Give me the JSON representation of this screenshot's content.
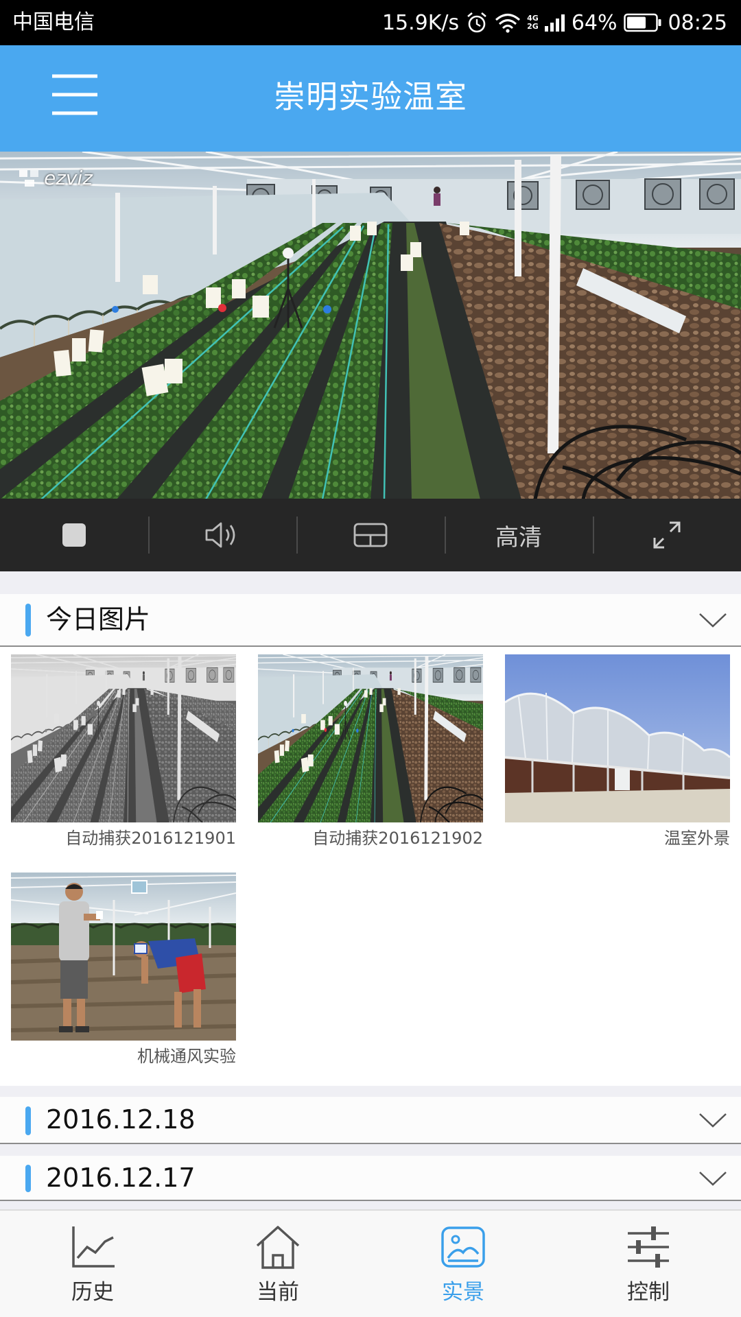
{
  "status_bar": {
    "carrier": "中国电信",
    "net_speed": "15.9K/s",
    "network_types": [
      "4G",
      "2G"
    ],
    "battery": "64%",
    "time": "08:25",
    "icons": [
      "alarm-icon",
      "wifi-icon",
      "signal-icon",
      "battery-icon"
    ]
  },
  "header": {
    "title": "崇明实验温室",
    "menu_icon": "menu-icon"
  },
  "video": {
    "watermark": "ezviz"
  },
  "controls": {
    "quality_label": "高清",
    "icons": [
      "stop-icon",
      "volume-icon",
      "split-screen-icon",
      "fullscreen-icon"
    ]
  },
  "sections": [
    {
      "title": "今日图片",
      "expanded": true,
      "photos": [
        {
          "caption": "自动捕获2016121901"
        },
        {
          "caption": "自动捕获2016121902"
        },
        {
          "caption": "温室外景"
        },
        {
          "caption": "机械通风实验"
        }
      ]
    },
    {
      "title": "2016.12.18",
      "expanded": false
    },
    {
      "title": "2016.12.17",
      "expanded": false
    }
  ],
  "bottom_nav": {
    "items": [
      {
        "label": "历史",
        "icon": "history-chart-icon",
        "active": false
      },
      {
        "label": "当前",
        "icon": "home-icon",
        "active": false
      },
      {
        "label": "实景",
        "icon": "image-icon",
        "active": true
      },
      {
        "label": "控制",
        "icon": "sliders-icon",
        "active": false
      }
    ]
  },
  "colors": {
    "primary": "#4AA8F0",
    "nav_active": "#3A9FEA",
    "control_bar": "#262626",
    "status_bar": "#000000"
  }
}
